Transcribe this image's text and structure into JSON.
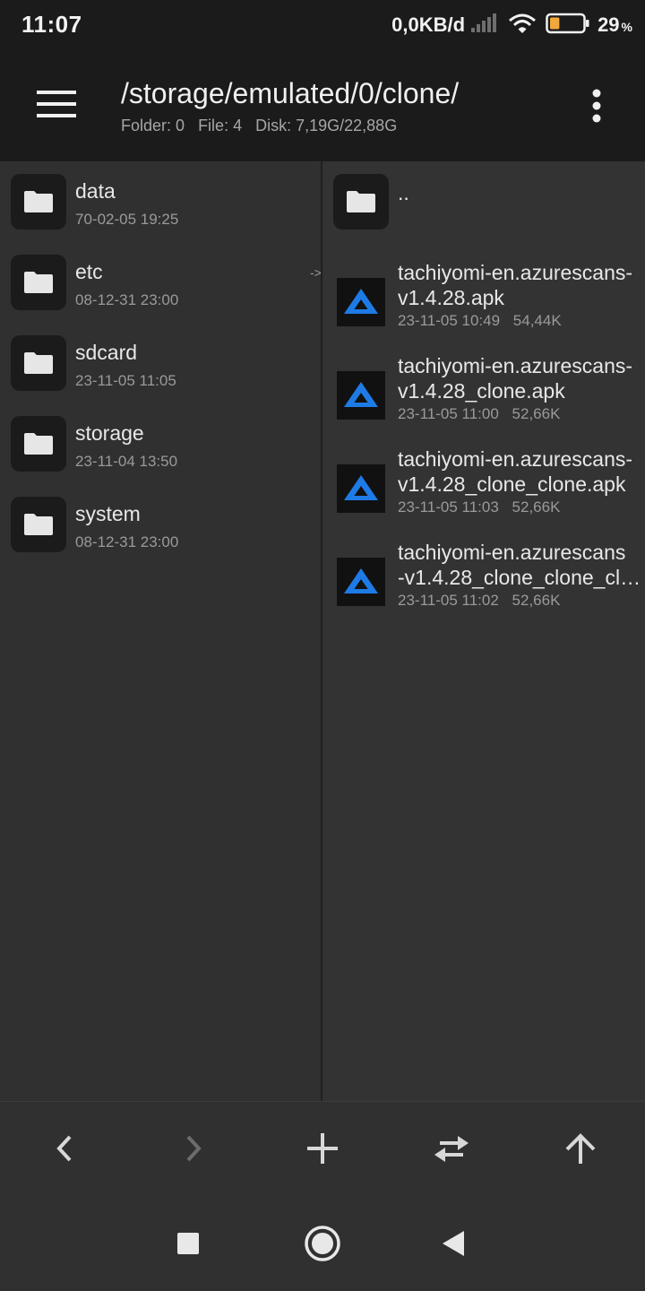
{
  "status_bar": {
    "time": "11:07",
    "network_speed": "0,0KB/d",
    "battery_percent": "29",
    "battery_unit": "%",
    "battery_level": 0.29,
    "icons": [
      "signal-icon",
      "wifi-icon",
      "battery-icon"
    ]
  },
  "toolbar": {
    "path": "/storage/emulated/0/clone/",
    "folder_count": "Folder: 0",
    "file_count": "File: 4",
    "disk": "Disk: 7,19G/22,88G",
    "menu_icon": "hamburger-menu-icon",
    "more_icon": "more-vert-icon"
  },
  "left_pane": {
    "items": [
      {
        "name": "data",
        "date": "70-02-05 19:25",
        "icon": "folder-icon"
      },
      {
        "name": "etc",
        "date": "08-12-31 23:00",
        "icon": "folder-icon"
      },
      {
        "name": "sdcard",
        "date": "23-11-05 11:05",
        "icon": "folder-icon"
      },
      {
        "name": "storage",
        "date": "23-11-04 13:50",
        "icon": "folder-icon"
      },
      {
        "name": "system",
        "date": "08-12-31 23:00",
        "icon": "folder-icon"
      }
    ],
    "link_marker": "->"
  },
  "right_pane": {
    "parent": {
      "name": "..",
      "icon": "folder-icon"
    },
    "files": [
      {
        "line1": "tachiyomi-en.azurescans-",
        "line2": "v1.4.28.apk",
        "date": "23-11-05 10:49",
        "size": "54,44K",
        "icon": "apk-app-icon"
      },
      {
        "line1": "tachiyomi-en.azurescans-",
        "line2": "v1.4.28_clone.apk",
        "date": "23-11-05 11:00",
        "size": "52,66K",
        "icon": "apk-app-icon"
      },
      {
        "line1": "tachiyomi-en.azurescans-",
        "line2": "v1.4.28_clone_clone.apk",
        "date": "23-11-05 11:03",
        "size": "52,66K",
        "icon": "apk-app-icon"
      },
      {
        "line1": "tachiyomi-en.azurescans",
        "line2": "-v1.4.28_clone_clone_clo...",
        "date": "23-11-05 11:02",
        "size": "52,66K",
        "icon": "apk-app-icon"
      }
    ]
  },
  "bottom_bar": {
    "buttons": [
      "back-icon",
      "forward-icon",
      "add-icon",
      "swap-icon",
      "up-icon"
    ]
  },
  "nav_bar": {
    "buttons": [
      "recents-icon",
      "home-icon",
      "back-nav-icon"
    ]
  },
  "colors": {
    "bar_bg": "#1b1b1b",
    "pane_bg": "#303030",
    "text": "#e8e8e8",
    "muted": "#9a9a9a",
    "apk_blue": "#1e7be6",
    "battery_fill": "#f2a93b"
  }
}
